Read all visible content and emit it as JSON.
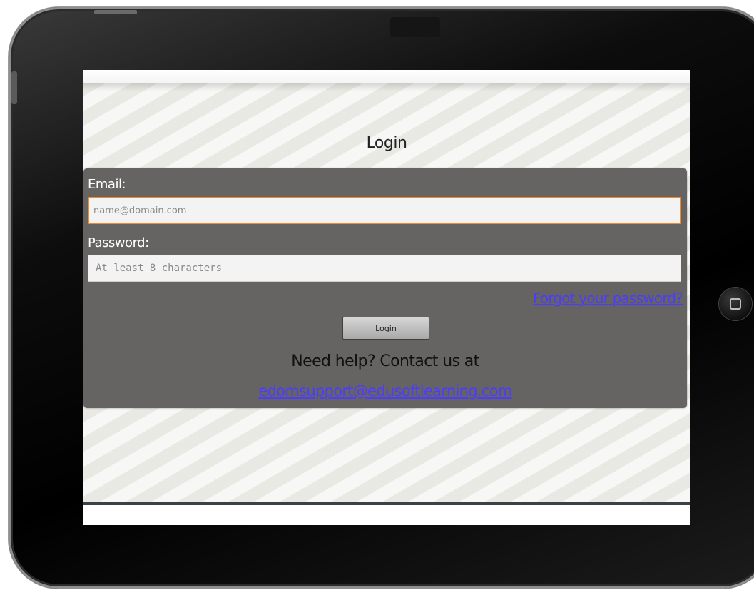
{
  "page": {
    "title": "Login"
  },
  "form": {
    "email_label": "Email:",
    "email_placeholder": "name@domain.com",
    "email_value": "",
    "password_label": "Password:",
    "password_placeholder": "At least 8 characters",
    "password_value": "",
    "forgot_link": "Forgot your password?",
    "login_button": "Login"
  },
  "help": {
    "text": "Need help? Contact us at",
    "email": "edomsupport@edusoftlearning.com"
  },
  "colors": {
    "panel": "#666462",
    "focus_border": "#f1892d",
    "link": "#4b3cff"
  }
}
